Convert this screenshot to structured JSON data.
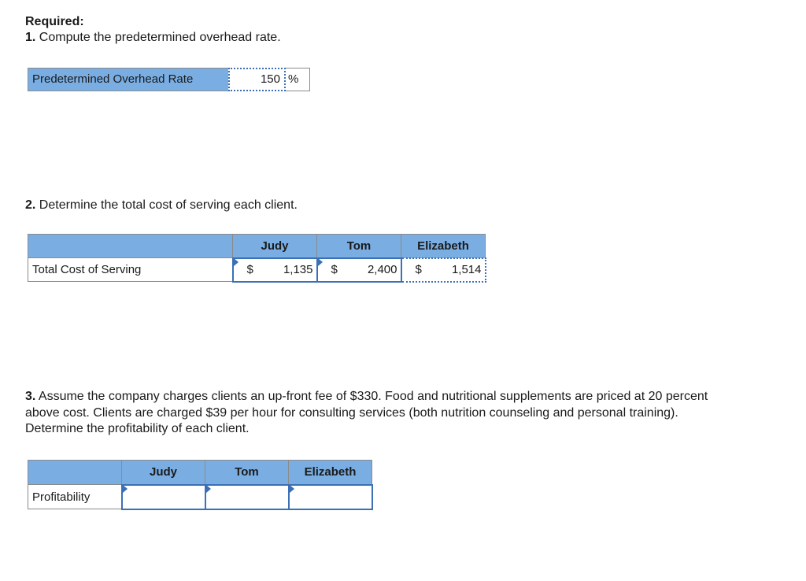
{
  "required_label": "Required:",
  "q1": {
    "number": "1.",
    "text": "Compute the predetermined overhead rate.",
    "row_label": "Predetermined Overhead Rate",
    "value": "150",
    "unit": "%"
  },
  "q2": {
    "number": "2.",
    "text": "Determine the total cost of serving each client.",
    "columns": [
      "Judy",
      "Tom",
      "Elizabeth"
    ],
    "row_label": "Total Cost of Serving",
    "currency": "$",
    "values": [
      "1,135",
      "2,400",
      "1,514"
    ]
  },
  "q3": {
    "number": "3.",
    "text_line1": "Assume the company charges clients an up-front fee of $330. Food and nutritional supplements are priced at 20 percent",
    "text_line2": "above cost. Clients are charged $39 per hour for consulting services (both nutrition counseling and personal training).",
    "text_line3": "Determine the profitability of each client.",
    "columns": [
      "Judy",
      "Tom",
      "Elizabeth"
    ],
    "row_label": "Profitability",
    "values": [
      "",
      "",
      ""
    ]
  },
  "colors": {
    "header_fill": "#7aaee3",
    "input_border": "#3b6fb6",
    "grid_border": "#8a8a8a"
  }
}
